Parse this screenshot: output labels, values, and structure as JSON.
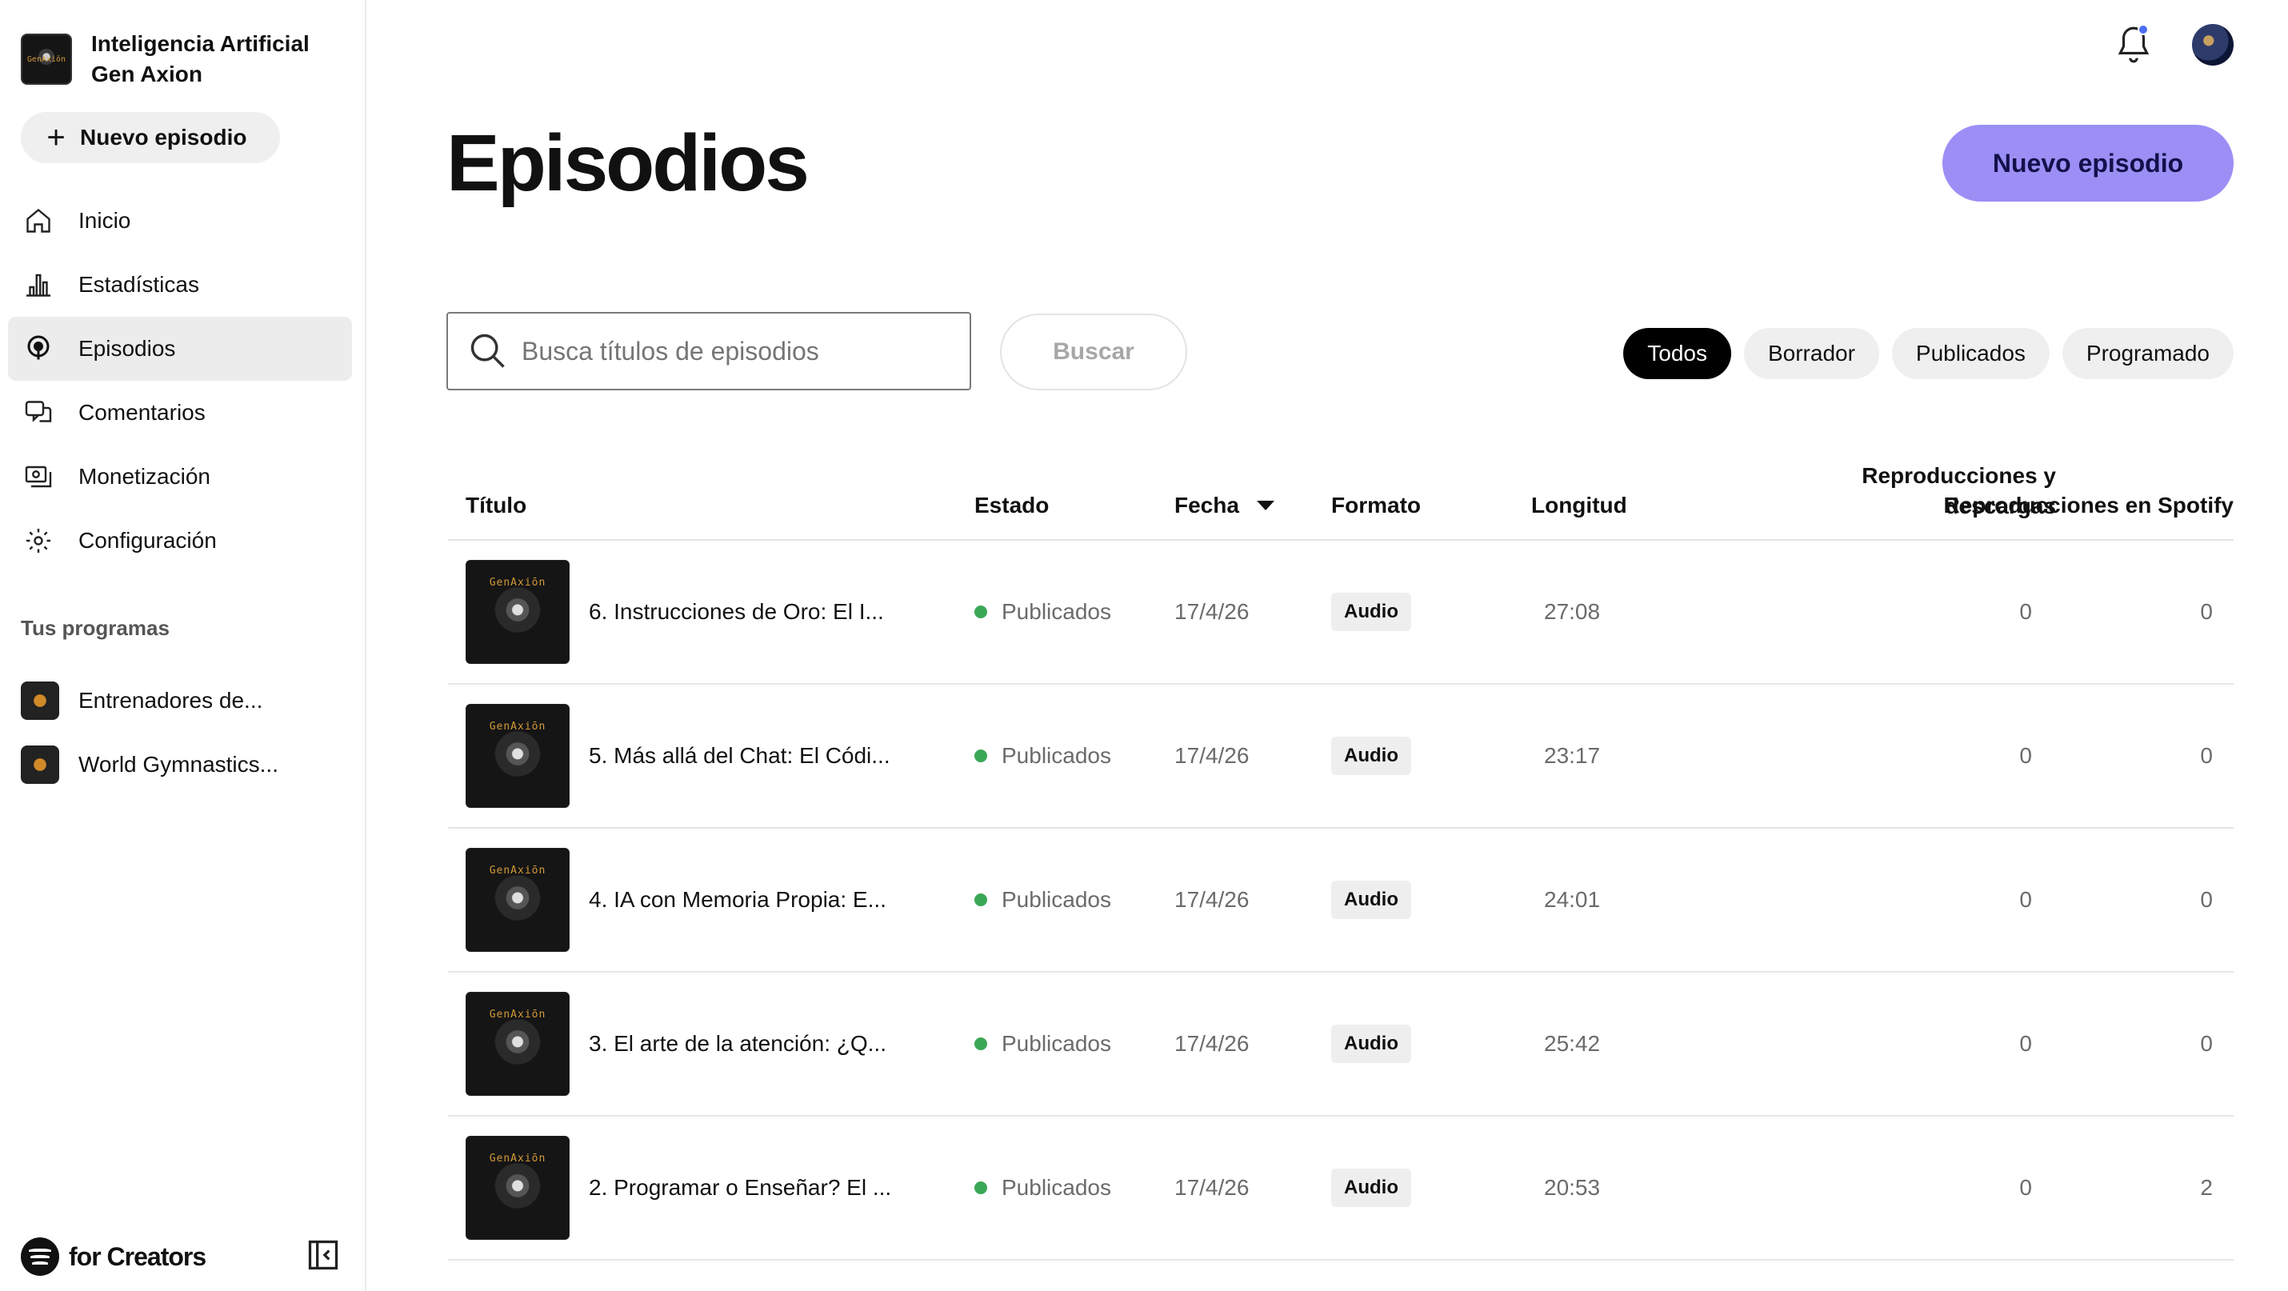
{
  "sidebar": {
    "brand_name": "Inteligencia Artificial Gen Axion",
    "brand_logo_text": "GenAxiōn",
    "new_episode_label": "Nuevo episodio",
    "items": [
      {
        "label": "Inicio",
        "icon": "home-icon",
        "active": false
      },
      {
        "label": "Estadísticas",
        "icon": "bar-chart-icon",
        "active": false
      },
      {
        "label": "Episodios",
        "icon": "podcast-icon",
        "active": true
      },
      {
        "label": "Comentarios",
        "icon": "comments-icon",
        "active": false
      },
      {
        "label": "Monetización",
        "icon": "monetization-icon",
        "active": false
      },
      {
        "label": "Configuración",
        "icon": "gear-icon",
        "active": false
      }
    ],
    "programs_title": "Tus programas",
    "programs": [
      {
        "label": "Entrenadores de..."
      },
      {
        "label": "World Gymnastics..."
      }
    ],
    "footer_brand": "for Creators"
  },
  "header": {
    "title": "Episodios",
    "new_episode_label": "Nuevo episodio"
  },
  "search": {
    "placeholder": "Busca títulos de episodios",
    "value": "",
    "button_label": "Buscar"
  },
  "filters": [
    {
      "label": "Todos",
      "active": true
    },
    {
      "label": "Borrador",
      "active": false
    },
    {
      "label": "Publicados",
      "active": false
    },
    {
      "label": "Programado",
      "active": false
    }
  ],
  "table": {
    "columns": {
      "title": "Título",
      "status": "Estado",
      "date": "Fecha",
      "format": "Formato",
      "length": "Longitud",
      "plays_line1": "Reproducciones y",
      "plays_line2": "descargas",
      "spotify": "Reproducciones en Spotify"
    },
    "rows": [
      {
        "title": "6. Instrucciones de Oro: El I...",
        "status": "Publicados",
        "date": "17/4/26",
        "format": "Audio",
        "length": "27:08",
        "plays": "0",
        "spotify": "0",
        "thumb_logo": "GenAxiōn"
      },
      {
        "title": "5. Más allá del Chat: El Códi...",
        "status": "Publicados",
        "date": "17/4/26",
        "format": "Audio",
        "length": "23:17",
        "plays": "0",
        "spotify": "0",
        "thumb_logo": "GenAxiōn"
      },
      {
        "title": "4. IA con Memoria Propia: E...",
        "status": "Publicados",
        "date": "17/4/26",
        "format": "Audio",
        "length": "24:01",
        "plays": "0",
        "spotify": "0",
        "thumb_logo": "GenAxiōn"
      },
      {
        "title": "3. El arte de la atención: ¿Q...",
        "status": "Publicados",
        "date": "17/4/26",
        "format": "Audio",
        "length": "25:42",
        "plays": "0",
        "spotify": "0",
        "thumb_logo": "GenAxiōn"
      },
      {
        "title": "2. Programar o Enseñar? El ...",
        "status": "Publicados",
        "date": "17/4/26",
        "format": "Audio",
        "length": "20:53",
        "plays": "0",
        "spotify": "2",
        "thumb_logo": "GenAxiōn"
      }
    ]
  },
  "colors": {
    "accent": "#9b8ff5",
    "status_green": "#3aa757",
    "notification_dot": "#4c6ef5"
  }
}
